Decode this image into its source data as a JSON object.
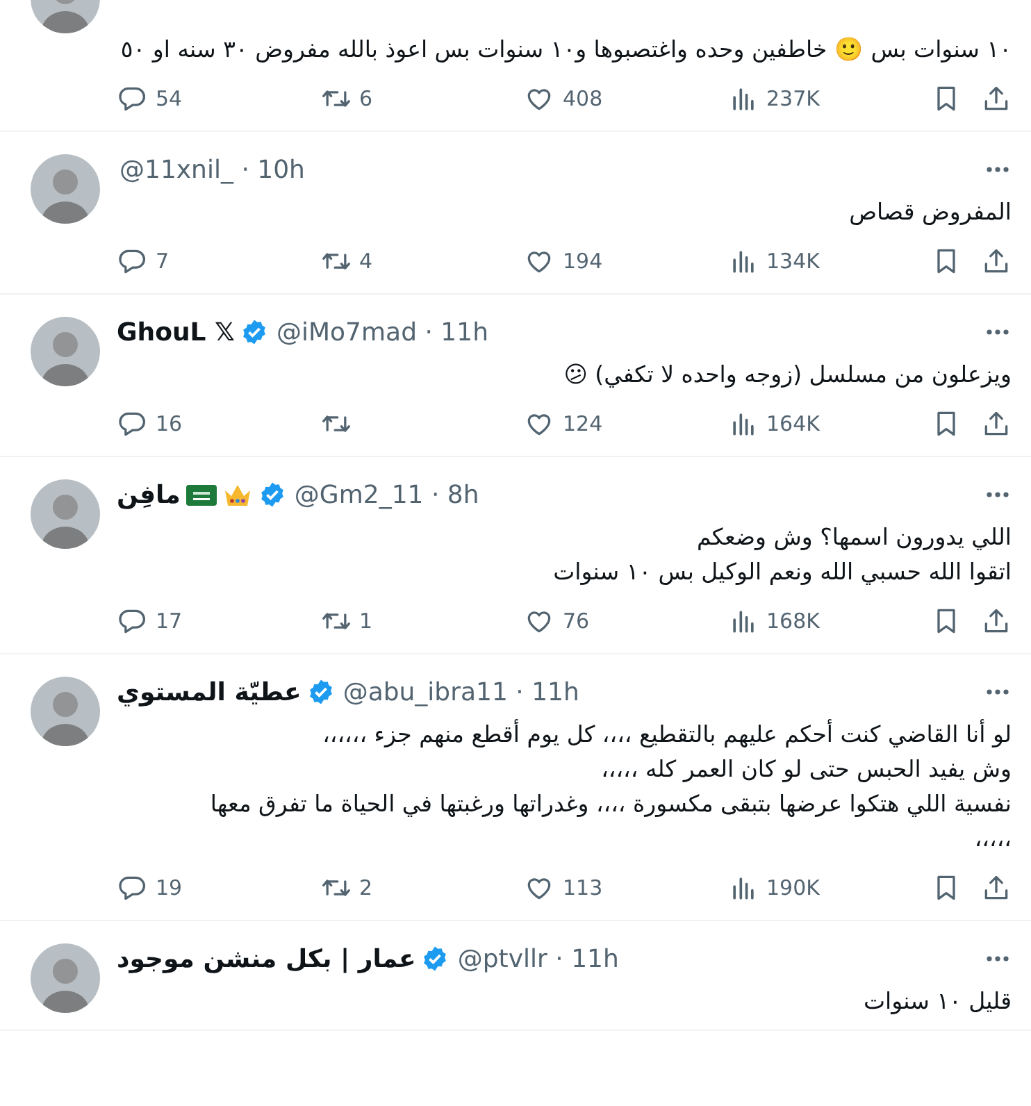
{
  "tweets": [
    {
      "text": "١٠ سنوات بس 🙂 خاطفين وحده واغتصبوها و١٠ سنوات بس اعوذ بالله مفروض ٣٠ سنه او ٥٠",
      "stats": {
        "replies": "54",
        "reposts": "6",
        "likes": "408",
        "views": "237K"
      }
    },
    {
      "meta": "@11xnil_ · 10h",
      "verified": false,
      "text": "المفروض قصاص",
      "stats": {
        "replies": "7",
        "reposts": "4",
        "likes": "194",
        "views": "134K"
      }
    },
    {
      "name": "GhouL 𝕏",
      "verified": true,
      "meta": "@iMo7mad · 11h",
      "text": "ويزعلون من مسلسل (زوجه واحده لا تكفي) 😕",
      "stats": {
        "replies": "16",
        "likes": "124",
        "views": "164K"
      }
    },
    {
      "name": "مافِن",
      "badges": [
        {
          "kind": "flag"
        },
        {
          "kind": "crown"
        }
      ],
      "verified": true,
      "meta": "@Gm2_11 · 8h",
      "text": "اللي يدورون اسمها؟ وش وضعكم\nاتقوا الله حسبي الله ونعم الوكيل بس ١٠ سنوات",
      "stats": {
        "replies": "17",
        "reposts": "1",
        "likes": "76",
        "views": "168K"
      }
    },
    {
      "name": "عطيّة المستوي",
      "verified": true,
      "meta": "@abu_ibra11 · 11h",
      "text": "لو أنا القاضي كنت أحكم عليهم بالتقطيع ،،،، كل يوم أقطع منهم جزء ،،،،،،\nوش يفيد الحبس حتى لو كان العمر كله ،،،،،\nنفسية اللي هتكوا عرضها بتبقى مكسورة ،،،، وغدراتها ورغبتها في الحياة ما تفرق معها\n،،،،،",
      "stats": {
        "replies": "19",
        "reposts": "2",
        "likes": "113",
        "views": "190K"
      }
    },
    {
      "name": "عمار | بكل منشن موجود",
      "verified": true,
      "meta": "@ptvllr · 11h",
      "text": "قليل ١٠ سنوات"
    }
  ]
}
